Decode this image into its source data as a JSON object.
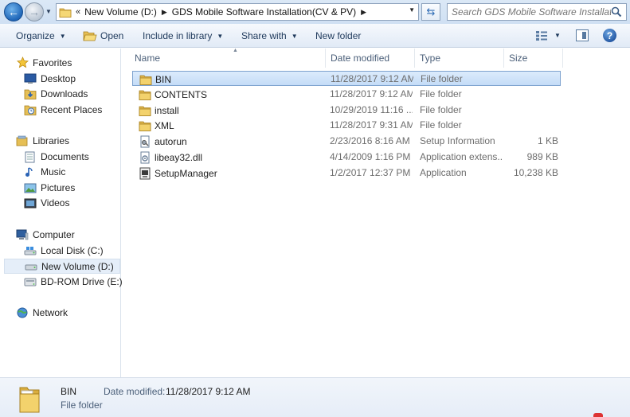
{
  "address": {
    "crumbs": [
      "New Volume (D:)",
      "GDS Mobile Software Installation(CV & PV)"
    ],
    "lead": "«"
  },
  "search": {
    "placeholder": "Search GDS Mobile Software Installati..."
  },
  "toolbar": {
    "organize": "Organize",
    "open": "Open",
    "include": "Include in library",
    "share": "Share with",
    "new_folder": "New folder"
  },
  "nav": {
    "favorites": "Favorites",
    "desktop": "Desktop",
    "downloads": "Downloads",
    "recent": "Recent Places",
    "libraries": "Libraries",
    "documents": "Documents",
    "music": "Music",
    "pictures": "Pictures",
    "videos": "Videos",
    "computer": "Computer",
    "local_disk": "Local Disk (C:)",
    "new_volume": "New Volume (D:)",
    "bdrom": "BD-ROM Drive (E:) C",
    "network": "Network"
  },
  "columns": {
    "name": "Name",
    "date": "Date modified",
    "type": "Type",
    "size": "Size"
  },
  "files": [
    {
      "name": "BIN",
      "date": "11/28/2017 9:12 AM",
      "type": "File folder",
      "size": "",
      "icon": "folder-icon"
    },
    {
      "name": "CONTENTS",
      "date": "11/28/2017 9:12 AM",
      "type": "File folder",
      "size": "",
      "icon": "folder-icon"
    },
    {
      "name": "install",
      "date": "10/29/2019 11:16 ...",
      "type": "File folder",
      "size": "",
      "icon": "folder-icon"
    },
    {
      "name": "XML",
      "date": "11/28/2017 9:31 AM",
      "type": "File folder",
      "size": "",
      "icon": "folder-icon"
    },
    {
      "name": "autorun",
      "date": "2/23/2016 8:16 AM",
      "type": "Setup Information",
      "size": "1 KB",
      "icon": "setup-info-icon"
    },
    {
      "name": "libeay32.dll",
      "date": "4/14/2009 1:16 PM",
      "type": "Application extens...",
      "size": "989 KB",
      "icon": "dll-icon"
    },
    {
      "name": "SetupManager",
      "date": "1/2/2017 12:37 PM",
      "type": "Application",
      "size": "10,238 KB",
      "icon": "application-icon"
    }
  ],
  "details": {
    "name": "BIN",
    "type": "File folder",
    "date_label": "Date modified:",
    "date_value": "11/28/2017 9:12 AM"
  },
  "colors": {
    "selection": "#cce0f7",
    "header_text": "#4c607a",
    "toolbar_text": "#1e395b"
  }
}
